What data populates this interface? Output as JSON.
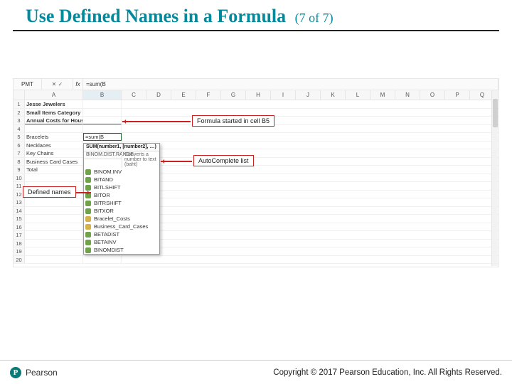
{
  "title": {
    "main": "Use Defined Names in a Formula",
    "sub": "(7 of 7)"
  },
  "formula_bar": {
    "name_box": "PMT",
    "btns": "✕  ✓",
    "fx": "fx",
    "formula": "=sum(B"
  },
  "columns": [
    "A",
    "B",
    "C",
    "D",
    "E",
    "F",
    "G",
    "H",
    "I",
    "J",
    "K",
    "L",
    "M",
    "N",
    "O",
    "P",
    "Q"
  ],
  "rows": {
    "r1": "Jesse Jewelers",
    "r2": "Small Items Category",
    "r3": "Annual Costs for Houston Store",
    "r5a": "Bracelets",
    "r5b": "=sum(B",
    "r6": "Necklaces",
    "r7": "Key Chains",
    "r8": "Business Card Cases",
    "r9": "Total"
  },
  "autocomplete": {
    "sig": "SUM(number1, [number2], …)",
    "tip": "Converts a number to text (baht)",
    "items": [
      {
        "t": "BINOM.DIST.RANGE",
        "k": "fn"
      },
      {
        "t": "BINOM.INV",
        "k": "fn"
      },
      {
        "t": "BITAND",
        "k": "fn"
      },
      {
        "t": "BITLSHIFT",
        "k": "fn"
      },
      {
        "t": "BITOR",
        "k": "fn"
      },
      {
        "t": "BITRSHIFT",
        "k": "fn"
      },
      {
        "t": "BITXOR",
        "k": "fn"
      },
      {
        "t": "Bracelet_Costs",
        "k": "nm"
      },
      {
        "t": "Business_Card_Cases",
        "k": "nm"
      },
      {
        "t": "BETADIST",
        "k": "fn"
      },
      {
        "t": "BETAINV",
        "k": "fn"
      },
      {
        "t": "BINOMDIST",
        "k": "fn"
      }
    ]
  },
  "callouts": {
    "c1": "Formula started in cell B5",
    "c2": "AutoComplete list",
    "c3": "Defined names"
  },
  "footer": {
    "brand_initial": "P",
    "brand": "Pearson",
    "copyright": "Copyright © 2017 Pearson Education, Inc. All Rights Reserved."
  }
}
